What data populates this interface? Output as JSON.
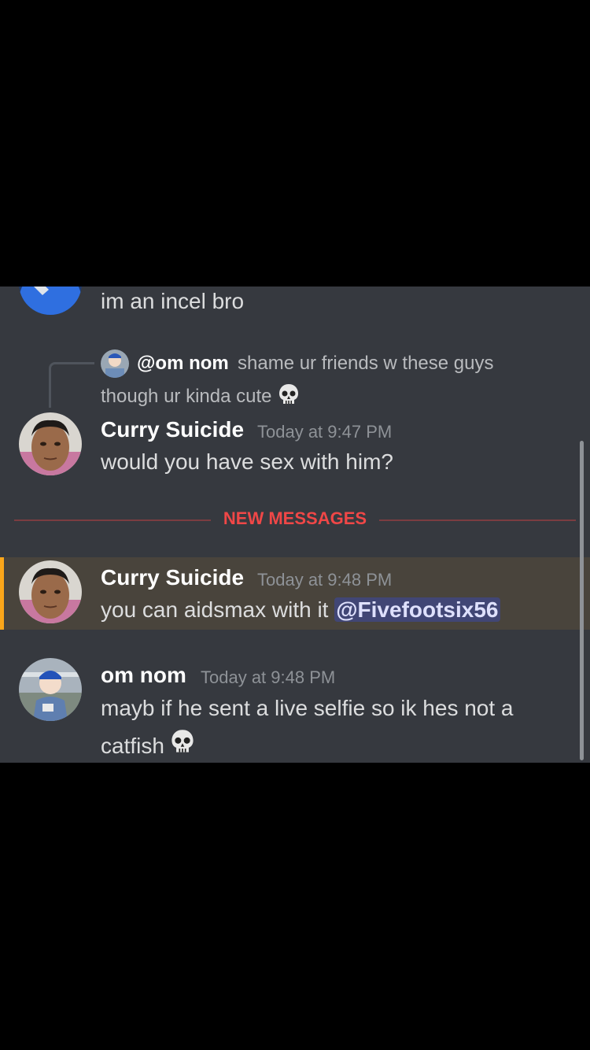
{
  "messages": {
    "top_partial": {
      "text": "im an incel bro"
    },
    "reply": {
      "author": "@om nom",
      "text_line1": "shame ur friends w these guys",
      "text_line2": "though ur kinda cute"
    },
    "msg1": {
      "author": "Curry Suicide",
      "timestamp": "Today at 9:47 PM",
      "text": "would you have sex with him?"
    },
    "divider": {
      "label": "NEW MESSAGES"
    },
    "msg2": {
      "author": "Curry Suicide",
      "timestamp": "Today at 9:48 PM",
      "text": "you can aidsmax with it ",
      "mention": "@Fivefootsix56"
    },
    "msg3": {
      "author": "om nom",
      "timestamp": "Today at 9:48 PM",
      "text_line1": "mayb if he sent a live selfie so ik hes not a",
      "text_line2": "catfish"
    }
  },
  "colors": {
    "background": "#36393f",
    "highlight": "#49443c",
    "highlight_bar": "#faa61a",
    "new_messages": "#f04747",
    "mention_bg": "#414675"
  },
  "icons": [
    "skull-emoji",
    "avatar-image"
  ]
}
